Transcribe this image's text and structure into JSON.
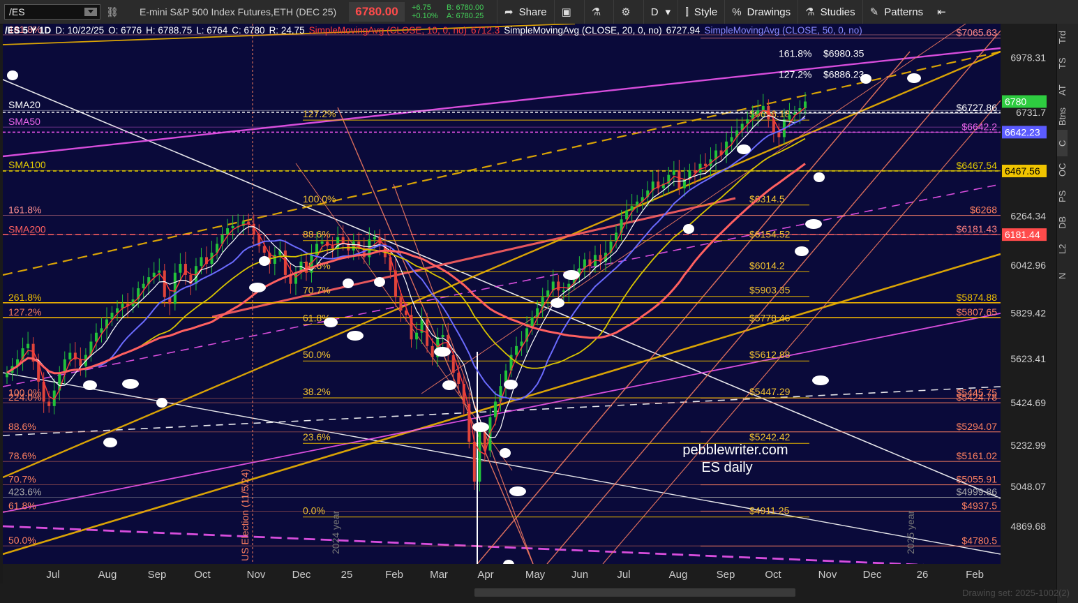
{
  "toolbar": {
    "symbol": "/ES",
    "description": "E-mini S&P 500 Index Futures,ETH (DEC 25)",
    "last_price": "6780.00",
    "change": "+6.75",
    "change_pct": "+0.10%",
    "bid": "B: 6780.00",
    "ask": "A: 6780.25",
    "share_label": "Share",
    "period_label": "D",
    "style_label": "Style",
    "drawings_label": "Drawings",
    "studies_label": "Studies",
    "patterns_label": "Patterns"
  },
  "header": {
    "title": "/ES 5 Y 1D",
    "date": "D: 10/22/25",
    "open": "O: 6776",
    "high": "H: 6788.75",
    "low": "L: 6764",
    "close": "C: 6780",
    "range": "R: 24.75",
    "sma10": "SimpleMovingAvg (CLOSE, 10, 0, no)",
    "sma10_val": "6712.3",
    "sma20": "SimpleMovingAvg (CLOSE, 20, 0, no)",
    "sma20_val": "6727.94",
    "sma50": "SimpleMovingAvg (CLOSE, 50, 0, no)"
  },
  "colors": {
    "background": "#0a0a3a",
    "up": "#22c33a",
    "down": "#e0443a",
    "sma10": "#ff3b3b",
    "sma20": "#ffffff",
    "sma50": "#6b6bff",
    "sma100": "#d9c400",
    "sma200": "#ff6060",
    "gold": "#f0b400",
    "magenta": "#ee55ee",
    "salmon": "#f07860"
  },
  "watermark": {
    "line1": "pebblewriter.com",
    "line2": "ES daily"
  },
  "vertical_labels": {
    "election": "US Election (11/5/24)",
    "y2024": "2024 year",
    "y2025": "2025 year"
  },
  "right_sidebar": [
    "Trd",
    "TS",
    "AT",
    "Btns",
    "C",
    "OC",
    "PS",
    "DB",
    "L2",
    "N"
  ],
  "drawing_set": "Drawing set: 2025-1002(2)",
  "chart_data": {
    "type": "candlestick",
    "ylim": [
      4700,
      7130
    ],
    "x_labels": [
      "Jul",
      "Aug",
      "Sep",
      "Oct",
      "Nov",
      "Dec",
      "25",
      "Feb",
      "Mar",
      "Apr",
      "May",
      "Jun",
      "Jul",
      "Aug",
      "Sep",
      "Oct",
      "Nov",
      "Dec",
      "26",
      "Feb"
    ],
    "y_ticks": [
      "6978.31",
      "6731.7",
      "6467.56",
      "6264.34",
      "6042.96",
      "5829.42",
      "5623.41",
      "5424.69",
      "5232.99",
      "5048.07",
      "4869.68"
    ],
    "price_tags": [
      {
        "label": "6780",
        "value": 6780,
        "color": "#2ecc40"
      },
      {
        "label": "6642.23",
        "value": 6642.23,
        "color": "#5b5bff"
      },
      {
        "label": "6467.56",
        "value": 6467.56,
        "color": "#f0c400"
      },
      {
        "label": "6181.44",
        "value": 6181.44,
        "color": "#ff4b4b"
      }
    ],
    "fib_center": [
      {
        "pct": "127.2%",
        "price": "$6696.18",
        "value": 6696.18
      },
      {
        "pct": "100.0%",
        "price": "$6314.5",
        "value": 6314.5
      },
      {
        "pct": "88.6%",
        "price": "$6154.52",
        "value": 6154.52
      },
      {
        "pct": "78.6%",
        "price": "$6014.2",
        "value": 6014.2
      },
      {
        "pct": "70.7%",
        "price": "$5903.35",
        "value": 5903.35
      },
      {
        "pct": "61.8%",
        "price": "$5778.46",
        "value": 5778.46
      },
      {
        "pct": "50.0%",
        "price": "$5612.88",
        "value": 5612.88
      },
      {
        "pct": "38.2%",
        "price": "$5447.29",
        "value": 5447.29
      },
      {
        "pct": "23.6%",
        "price": "$5242.42",
        "value": 5242.42
      },
      {
        "pct": "0.0%",
        "price": "$4911.25",
        "value": 4911.25
      }
    ],
    "fib_top": [
      {
        "pct": "161.8%",
        "price": "$6980.35",
        "value": 6980.35
      },
      {
        "pct": "127.2%",
        "price": "$6886.23",
        "value": 6886.23
      }
    ],
    "right_levels": [
      {
        "label": "$7065.63",
        "value": 7065.63,
        "color": "#ff8888"
      },
      {
        "label": "$6727.86",
        "value": 6727.86,
        "color": "#ffffff"
      },
      {
        "label": "$6642.2",
        "value": 6642.2,
        "color": "#ee66ee"
      },
      {
        "label": "$6467.54",
        "value": 6467.54,
        "color": "#e8d000"
      },
      {
        "label": "$6268",
        "value": 6268,
        "color": "#ff8060"
      },
      {
        "label": "$6181.43",
        "value": 6181.43,
        "color": "#ff8080"
      },
      {
        "label": "$5874.88",
        "value": 5874.88,
        "color": "#f0c000"
      },
      {
        "label": "$5807.65",
        "value": 5807.65,
        "color": "#ff8060"
      },
      {
        "label": "$5445.75",
        "value": 5445.75,
        "color": "#ff8060"
      },
      {
        "label": "$5424.78",
        "value": 5424.78,
        "color": "#ff8060"
      },
      {
        "label": "$5294.07",
        "value": 5294.07,
        "color": "#ff8060"
      },
      {
        "label": "$5161.02",
        "value": 5161.02,
        "color": "#ff8060"
      },
      {
        "label": "$5055.91",
        "value": 5055.91,
        "color": "#ff8060"
      },
      {
        "label": "$4999.86",
        "value": 4999.86,
        "color": "#aaaaaa"
      },
      {
        "label": "$4937.5",
        "value": 4937.5,
        "color": "#ff8060"
      },
      {
        "label": "$4780.5",
        "value": 4780.5,
        "color": "#ff8060"
      }
    ],
    "left_labels": [
      {
        "label": "161.8%",
        "value": 7080,
        "color": "#ff9090"
      },
      {
        "label": "SMA20",
        "value": 6740,
        "color": "#ffffff"
      },
      {
        "label": "SMA50",
        "value": 6665,
        "color": "#ee66ee"
      },
      {
        "label": "SMA100",
        "value": 6470,
        "color": "#e8d000"
      },
      {
        "label": "161.8%",
        "value": 6268,
        "color": "#ff9090"
      },
      {
        "label": "SMA200",
        "value": 6180,
        "color": "#ff6060"
      },
      {
        "label": "261.8%",
        "value": 5874,
        "color": "#f0c000"
      },
      {
        "label": "127.2%",
        "value": 5808,
        "color": "#ff8060"
      },
      {
        "label": "100.0%",
        "value": 5446,
        "color": "#ff8060"
      },
      {
        "label": "224.0%",
        "value": 5425,
        "color": "#ff8060"
      },
      {
        "label": "88.6%",
        "value": 5294,
        "color": "#ff8060"
      },
      {
        "label": "78.6%",
        "value": 5161,
        "color": "#ff8060"
      },
      {
        "label": "70.7%",
        "value": 5056,
        "color": "#ff8060"
      },
      {
        "label": "423.6%",
        "value": 5000,
        "color": "#aaaaaa"
      },
      {
        "label": "61.8%",
        "value": 4937,
        "color": "#ff8060"
      },
      {
        "label": "50.0%",
        "value": 4781,
        "color": "#ff8060"
      }
    ],
    "close_series": [
      5560,
      5590,
      5620,
      5670,
      5690,
      5610,
      5520,
      5430,
      5410,
      5480,
      5560,
      5620,
      5650,
      5620,
      5590,
      5640,
      5700,
      5740,
      5760,
      5800,
      5830,
      5850,
      5870,
      5860,
      5890,
      5940,
      5960,
      5990,
      6010,
      6020,
      5900,
      5870,
      6010,
      6050,
      6000,
      5960,
      6040,
      6080,
      6050,
      6100,
      6140,
      6180,
      6210,
      6220,
      6220,
      6240,
      6230,
      6180,
      6130,
      6100,
      6050,
      6090,
      6110,
      6000,
      5960,
      6010,
      6060,
      6010,
      6090,
      6140,
      6150,
      6130,
      6120,
      6170,
      6140,
      6110,
      6150,
      6120,
      6080,
      6160,
      6170,
      6140,
      6080,
      6020,
      5900,
      5840,
      5820,
      5710,
      5740,
      5800,
      5680,
      5630,
      5720,
      5730,
      5640,
      5560,
      5510,
      5420,
      5250,
      5070,
      5300,
      5210,
      5360,
      5430,
      5500,
      5570,
      5640,
      5680,
      5700,
      5760,
      5810,
      5850,
      5900,
      5930,
      5970,
      5930,
      5930,
      5960,
      6000,
      6030,
      6070,
      6040,
      6090,
      6060,
      6100,
      6150,
      6190,
      6250,
      6290,
      6310,
      6330,
      6350,
      6380,
      6420,
      6390,
      6410,
      6450,
      6470,
      6390,
      6430,
      6470,
      6460,
      6500,
      6490,
      6520,
      6560,
      6540,
      6600,
      6620,
      6650,
      6680,
      6700,
      6720,
      6740,
      6760,
      6700,
      6640,
      6620,
      6700,
      6720,
      6730,
      6750,
      6780
    ],
    "horizontal_levels_gold": [
      5874.88,
      5807.65
    ]
  }
}
